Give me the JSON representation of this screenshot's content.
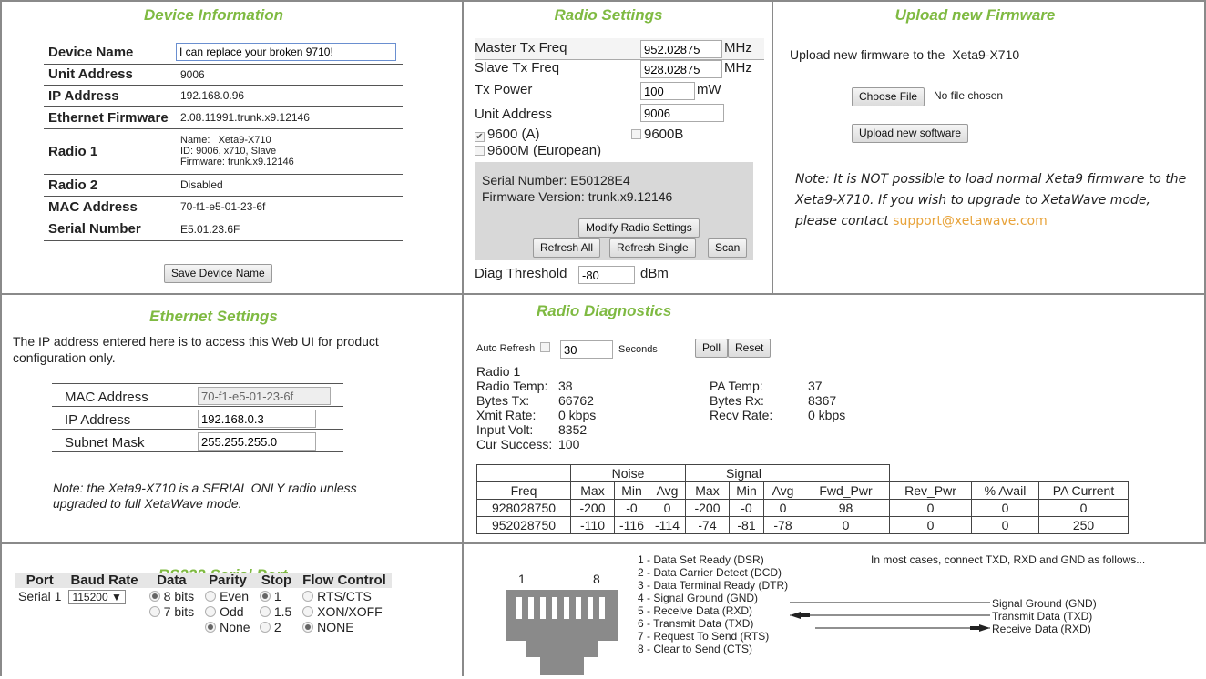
{
  "device": {
    "title": "Device Information",
    "rows": [
      {
        "label": "Device Name",
        "value": "I can replace your broken 9710!"
      },
      {
        "label": "Unit Address",
        "value": "9006"
      },
      {
        "label": "IP Address",
        "value": "192.168.0.96"
      },
      {
        "label": "Ethernet Firmware",
        "value": "2.08.11991.trunk.x9.12146"
      },
      {
        "label": "Radio 1",
        "lines": [
          "Name:   Xeta9-X710",
          "ID: 9006, x710, Slave",
          "Firmware: trunk.x9.12146"
        ]
      },
      {
        "label": "Radio 2",
        "value": "Disabled"
      },
      {
        "label": "MAC Address",
        "value": "70-f1-e5-01-23-6f"
      },
      {
        "label": "Serial Number",
        "value": "E5.01.23.6F"
      }
    ],
    "save_button": "Save Device Name"
  },
  "radio": {
    "title": "Radio Settings",
    "master_label": "Master Tx Freq",
    "master_value": "952.02875",
    "master_unit": "MHz",
    "slave_label": "Slave Tx Freq",
    "slave_value": "928.02875",
    "slave_unit": "MHz",
    "power_label": "Tx Power",
    "power_value": "100",
    "power_unit": "mW",
    "unit_label": "Unit Address",
    "unit_value": "9006",
    "opt_9600": "9600 (A)",
    "opt_9600b": "9600B",
    "opt_9600m": "9600M (European)",
    "serial_line": "Serial Number: E50128E4",
    "firmware_line": "Firmware Version: trunk.x9.12146",
    "modify_button": "Modify Radio Settings",
    "refresh_all": "Refresh All",
    "refresh_single": "Refresh Single",
    "scan": "Scan",
    "diag_label": "Diag Threshold",
    "diag_value": "-80",
    "diag_unit": "dBm"
  },
  "firmware": {
    "title": "Upload new Firmware",
    "intro": "Upload new firmware to the  Xeta9-X710",
    "choose_button": "Choose File",
    "no_file": "No file chosen",
    "upload_button": "Upload new software",
    "note": "Note: It is NOT possible to load normal Xeta9 firmware to the Xeta9-X710.  If you wish to upgrade to XetaWave mode, please contact",
    "email": "support@xetawave.com"
  },
  "ethernet": {
    "title": "Ethernet Settings",
    "intro": "The IP address entered here is to access this Web UI for product configuration only.",
    "mac_label": "MAC Address",
    "mac_value": "70-f1-e5-01-23-6f",
    "ip_label": "IP Address",
    "ip_value": "192.168.0.3",
    "mask_label": "Subnet Mask",
    "mask_value": "255.255.255.0",
    "note": "Note: the Xeta9-X710 is a SERIAL ONLY radio unless upgraded to full XetaWave mode."
  },
  "diagnostics": {
    "title": "Radio Diagnostics",
    "auto_refresh_label": "Auto Refresh",
    "auto_refresh_value": "30",
    "seconds": "Seconds",
    "poll": "Poll",
    "reset": "Reset",
    "radio_label": "Radio 1",
    "radio_temp_label": "Radio Temp:",
    "radio_temp": "38",
    "pa_temp_label": "PA Temp:",
    "pa_temp": "37",
    "bytes_tx_label": "Bytes Tx:",
    "bytes_tx": "66762",
    "bytes_rx_label": "Bytes Rx:",
    "bytes_rx": "8367",
    "xmit_label": "Xmit Rate:",
    "xmit": "0 kbps",
    "recv_label": "Recv Rate:",
    "recv": "0 kbps",
    "volt_label": "Input Volt:",
    "volt": "8352",
    "success_label": "Cur Success:",
    "success": "100",
    "group_noise": "Noise",
    "group_signal": "Signal",
    "headers": [
      "Freq",
      "Max",
      "Min",
      "Avg",
      "Max",
      "Min",
      "Avg",
      "Fwd_Pwr",
      "Rev_Pwr",
      "% Avail",
      "PA Current"
    ],
    "rows": [
      [
        "928028750",
        "-200",
        "-0",
        "0",
        "-200",
        "-0",
        "0",
        "98",
        "0",
        "0",
        "0"
      ],
      [
        "952028750",
        "-110",
        "-116",
        "-114",
        "-74",
        "-81",
        "-78",
        "0",
        "0",
        "0",
        "250"
      ]
    ]
  },
  "serial": {
    "title": "RS232 Serial Port",
    "headers": [
      "Port",
      "Baud Rate",
      "Data",
      "Parity",
      "Stop",
      "Flow Control"
    ],
    "port": "Serial 1",
    "baud": "115200 ▼",
    "data_opts": [
      "8 bits",
      "7 bits"
    ],
    "parity_opts": [
      "Even",
      "Odd",
      "None"
    ],
    "stop_opts": [
      "1",
      "1.5",
      "2"
    ],
    "flow_opts": [
      "RTS/CTS",
      "XON/XOFF",
      "NONE"
    ]
  },
  "wiring": {
    "pin_left": "1",
    "pin_right": "8",
    "pins": [
      "1 - Data Set Ready (DSR)",
      "2 - Data Carrier Detect (DCD)",
      "3 - Data Terminal Ready (DTR)",
      "4 - Signal Ground (GND)",
      "5 - Receive Data  (RXD)",
      "6 - Transmit Data (TXD)",
      "7 - Request To Send (RTS)",
      "8 - Clear to Send (CTS)"
    ],
    "hint": "In most cases, connect TXD, RXD and GND as follows...",
    "targets": [
      "Signal Ground (GND)",
      "Transmit Data (TXD)",
      "Receive Data (RXD)"
    ]
  }
}
